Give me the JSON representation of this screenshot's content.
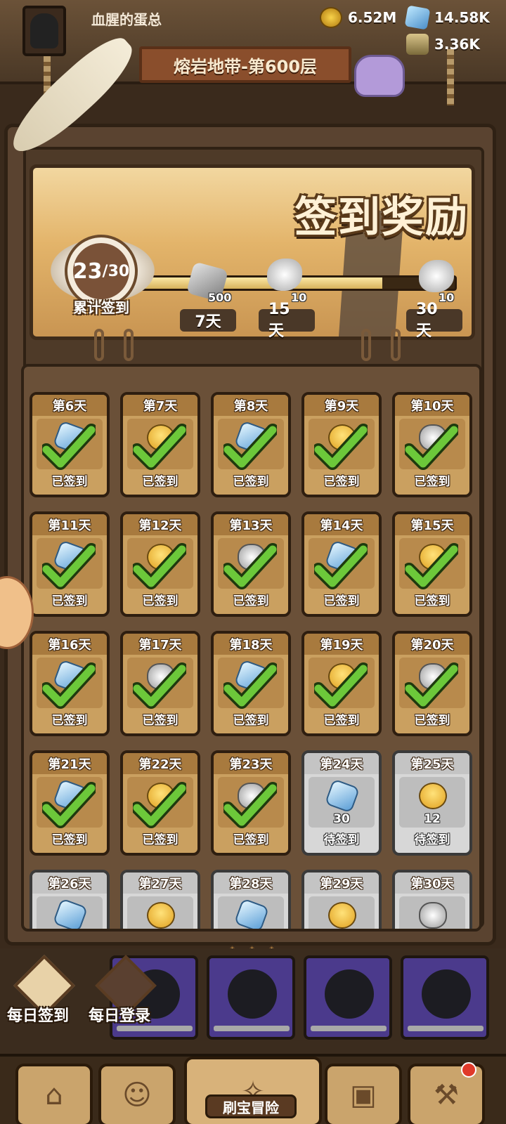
{
  "player": {
    "name": "血腥的蛋总"
  },
  "resources": {
    "coins": "6.52M",
    "gems": "14.58K",
    "jars": "3.36K"
  },
  "stage": {
    "title": "熔岩地带-第600层"
  },
  "signin": {
    "title": "签到奖励",
    "progress": {
      "count": "23",
      "total": "/30",
      "label": "累计签到",
      "fraction": 0.767
    },
    "milestones": [
      {
        "qty": "500",
        "day": "7天",
        "icon": "stone-icon"
      },
      {
        "qty": "10",
        "day": "15天",
        "icon": "scroll-icon"
      },
      {
        "qty": "10",
        "day": "30天",
        "icon": "scroll-icon"
      }
    ],
    "days": [
      {
        "label": "第6天",
        "status": "已签到",
        "signed": true,
        "icon": "gem",
        "qty": ""
      },
      {
        "label": "第7天",
        "status": "已签到",
        "signed": true,
        "icon": "hero",
        "qty": ""
      },
      {
        "label": "第8天",
        "status": "已签到",
        "signed": true,
        "icon": "gem",
        "qty": ""
      },
      {
        "label": "第9天",
        "status": "已签到",
        "signed": true,
        "icon": "hero",
        "qty": ""
      },
      {
        "label": "第10天",
        "status": "已签到",
        "signed": true,
        "icon": "silver",
        "qty": ""
      },
      {
        "label": "第11天",
        "status": "已签到",
        "signed": true,
        "icon": "gem",
        "qty": ""
      },
      {
        "label": "第12天",
        "status": "已签到",
        "signed": true,
        "icon": "hero",
        "qty": ""
      },
      {
        "label": "第13天",
        "status": "已签到",
        "signed": true,
        "icon": "silver",
        "qty": ""
      },
      {
        "label": "第14天",
        "status": "已签到",
        "signed": true,
        "icon": "gem",
        "qty": ""
      },
      {
        "label": "第15天",
        "status": "已签到",
        "signed": true,
        "icon": "hero",
        "qty": ""
      },
      {
        "label": "第16天",
        "status": "已签到",
        "signed": true,
        "icon": "gem",
        "qty": ""
      },
      {
        "label": "第17天",
        "status": "已签到",
        "signed": true,
        "icon": "silver",
        "qty": ""
      },
      {
        "label": "第18天",
        "status": "已签到",
        "signed": true,
        "icon": "gem",
        "qty": ""
      },
      {
        "label": "第19天",
        "status": "已签到",
        "signed": true,
        "icon": "hero",
        "qty": ""
      },
      {
        "label": "第20天",
        "status": "已签到",
        "signed": true,
        "icon": "silver",
        "qty": ""
      },
      {
        "label": "第21天",
        "status": "已签到",
        "signed": true,
        "icon": "gem",
        "qty": ""
      },
      {
        "label": "第22天",
        "status": "已签到",
        "signed": true,
        "icon": "hero",
        "qty": ""
      },
      {
        "label": "第23天",
        "status": "已签到",
        "signed": true,
        "icon": "silver",
        "qty": ""
      },
      {
        "label": "第24天",
        "status": "待签到",
        "signed": false,
        "icon": "gem",
        "qty": "30"
      },
      {
        "label": "第25天",
        "status": "待签到",
        "signed": false,
        "icon": "hero",
        "qty": "12"
      },
      {
        "label": "第26天",
        "status": "",
        "signed": false,
        "icon": "gem",
        "qty": ""
      },
      {
        "label": "第27天",
        "status": "",
        "signed": false,
        "icon": "hero",
        "qty": ""
      },
      {
        "label": "第28天",
        "status": "",
        "signed": false,
        "icon": "gem",
        "qty": ""
      },
      {
        "label": "第29天",
        "status": "",
        "signed": false,
        "icon": "hero",
        "qty": ""
      },
      {
        "label": "第30天",
        "status": "",
        "signed": false,
        "icon": "silver",
        "qty": ""
      }
    ]
  },
  "quick_actions": [
    {
      "label": "每日签到",
      "icon": "calendar-check-icon"
    },
    {
      "label": "每日登录",
      "icon": "gift-icon"
    }
  ],
  "nav": {
    "center_label": "刷宝冒险"
  },
  "colors": {
    "signed_card": "#caa060",
    "pending_card": "#d7d7d7",
    "check": "#6cc83a"
  }
}
